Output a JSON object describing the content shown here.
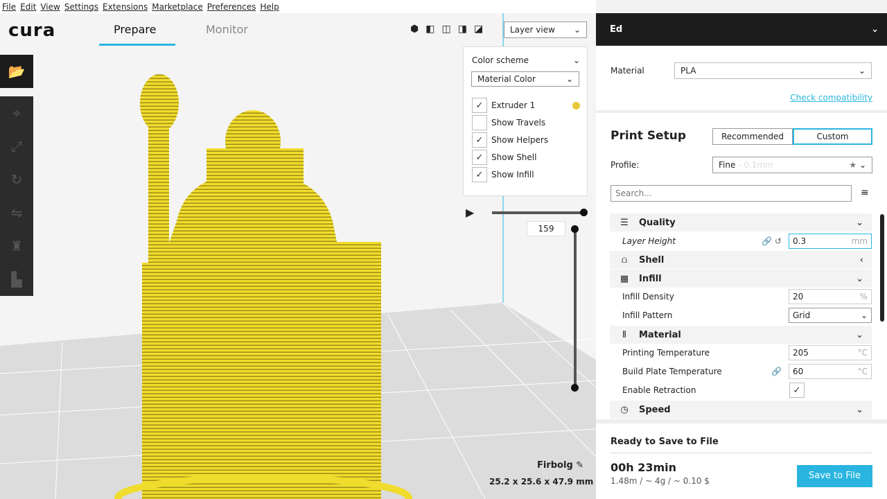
{
  "menu": [
    "File",
    "Edit",
    "View",
    "Settings",
    "Extensions",
    "Marketplace",
    "Preferences",
    "Help"
  ],
  "header": {
    "logo": "cura",
    "tabs": [
      {
        "label": "Prepare",
        "active": true
      },
      {
        "label": "Monitor",
        "active": false
      }
    ],
    "view_mode": "Layer view",
    "view_icons": [
      "3d-view-icon",
      "front-view-icon",
      "top-view-icon",
      "left-view-icon",
      "right-view-icon"
    ]
  },
  "sidebar": [
    "open-folder-icon",
    "translate-icon",
    "scale-icon",
    "rotate-icon",
    "mirror-icon",
    "per-model-settings-icon",
    "support-blocker-icon"
  ],
  "layer_panel": {
    "color_scheme_label": "Color scheme",
    "color_scheme": "Material Color",
    "items": [
      {
        "label": "Extruder 1",
        "checked": true,
        "swatch": "#e8c93a"
      },
      {
        "label": "Show Travels",
        "checked": false
      },
      {
        "label": "Show Helpers",
        "checked": true
      },
      {
        "label": "Show Shell",
        "checked": true
      },
      {
        "label": "Show Infill",
        "checked": true
      }
    ]
  },
  "layer_slider": {
    "current_layer": "159"
  },
  "model": {
    "name": "Firbolg",
    "dimensions": "25.2 x 25.6 x 47.9 mm",
    "color": "#f0dc2c"
  },
  "printer": {
    "name": "Ed",
    "material_label": "Material",
    "material": "PLA",
    "check_compat": "Check compatibility"
  },
  "print_setup": {
    "title": "Print Setup",
    "modes": [
      "Recommended",
      "Custom"
    ],
    "active_mode": "Custom",
    "profile_label": "Profile:",
    "profile": "Fine",
    "profile_detail": "- 0.1mm",
    "search_placeholder": "Search..."
  },
  "settings": {
    "quality": {
      "label": "Quality",
      "layer_height_label": "Layer Height",
      "layer_height": "0.3",
      "unit": "mm"
    },
    "shell": {
      "label": "Shell"
    },
    "infill": {
      "label": "Infill",
      "density_label": "Infill Density",
      "density": "20",
      "density_unit": "%",
      "pattern_label": "Infill Pattern",
      "pattern": "Grid"
    },
    "material": {
      "label": "Material",
      "print_temp_label": "Printing Temperature",
      "print_temp": "205",
      "bed_temp_label": "Build Plate Temperature",
      "bed_temp": "60",
      "temp_unit": "°C",
      "retraction_label": "Enable Retraction",
      "retraction": true
    },
    "speed": {
      "label": "Speed"
    }
  },
  "output": {
    "status": "Ready to Save to File",
    "time": "00h 23min",
    "details": "1.48m / ~ 4g / ~ 0.10 $",
    "save_label": "Save to File",
    "accent": "#29b5e0"
  }
}
